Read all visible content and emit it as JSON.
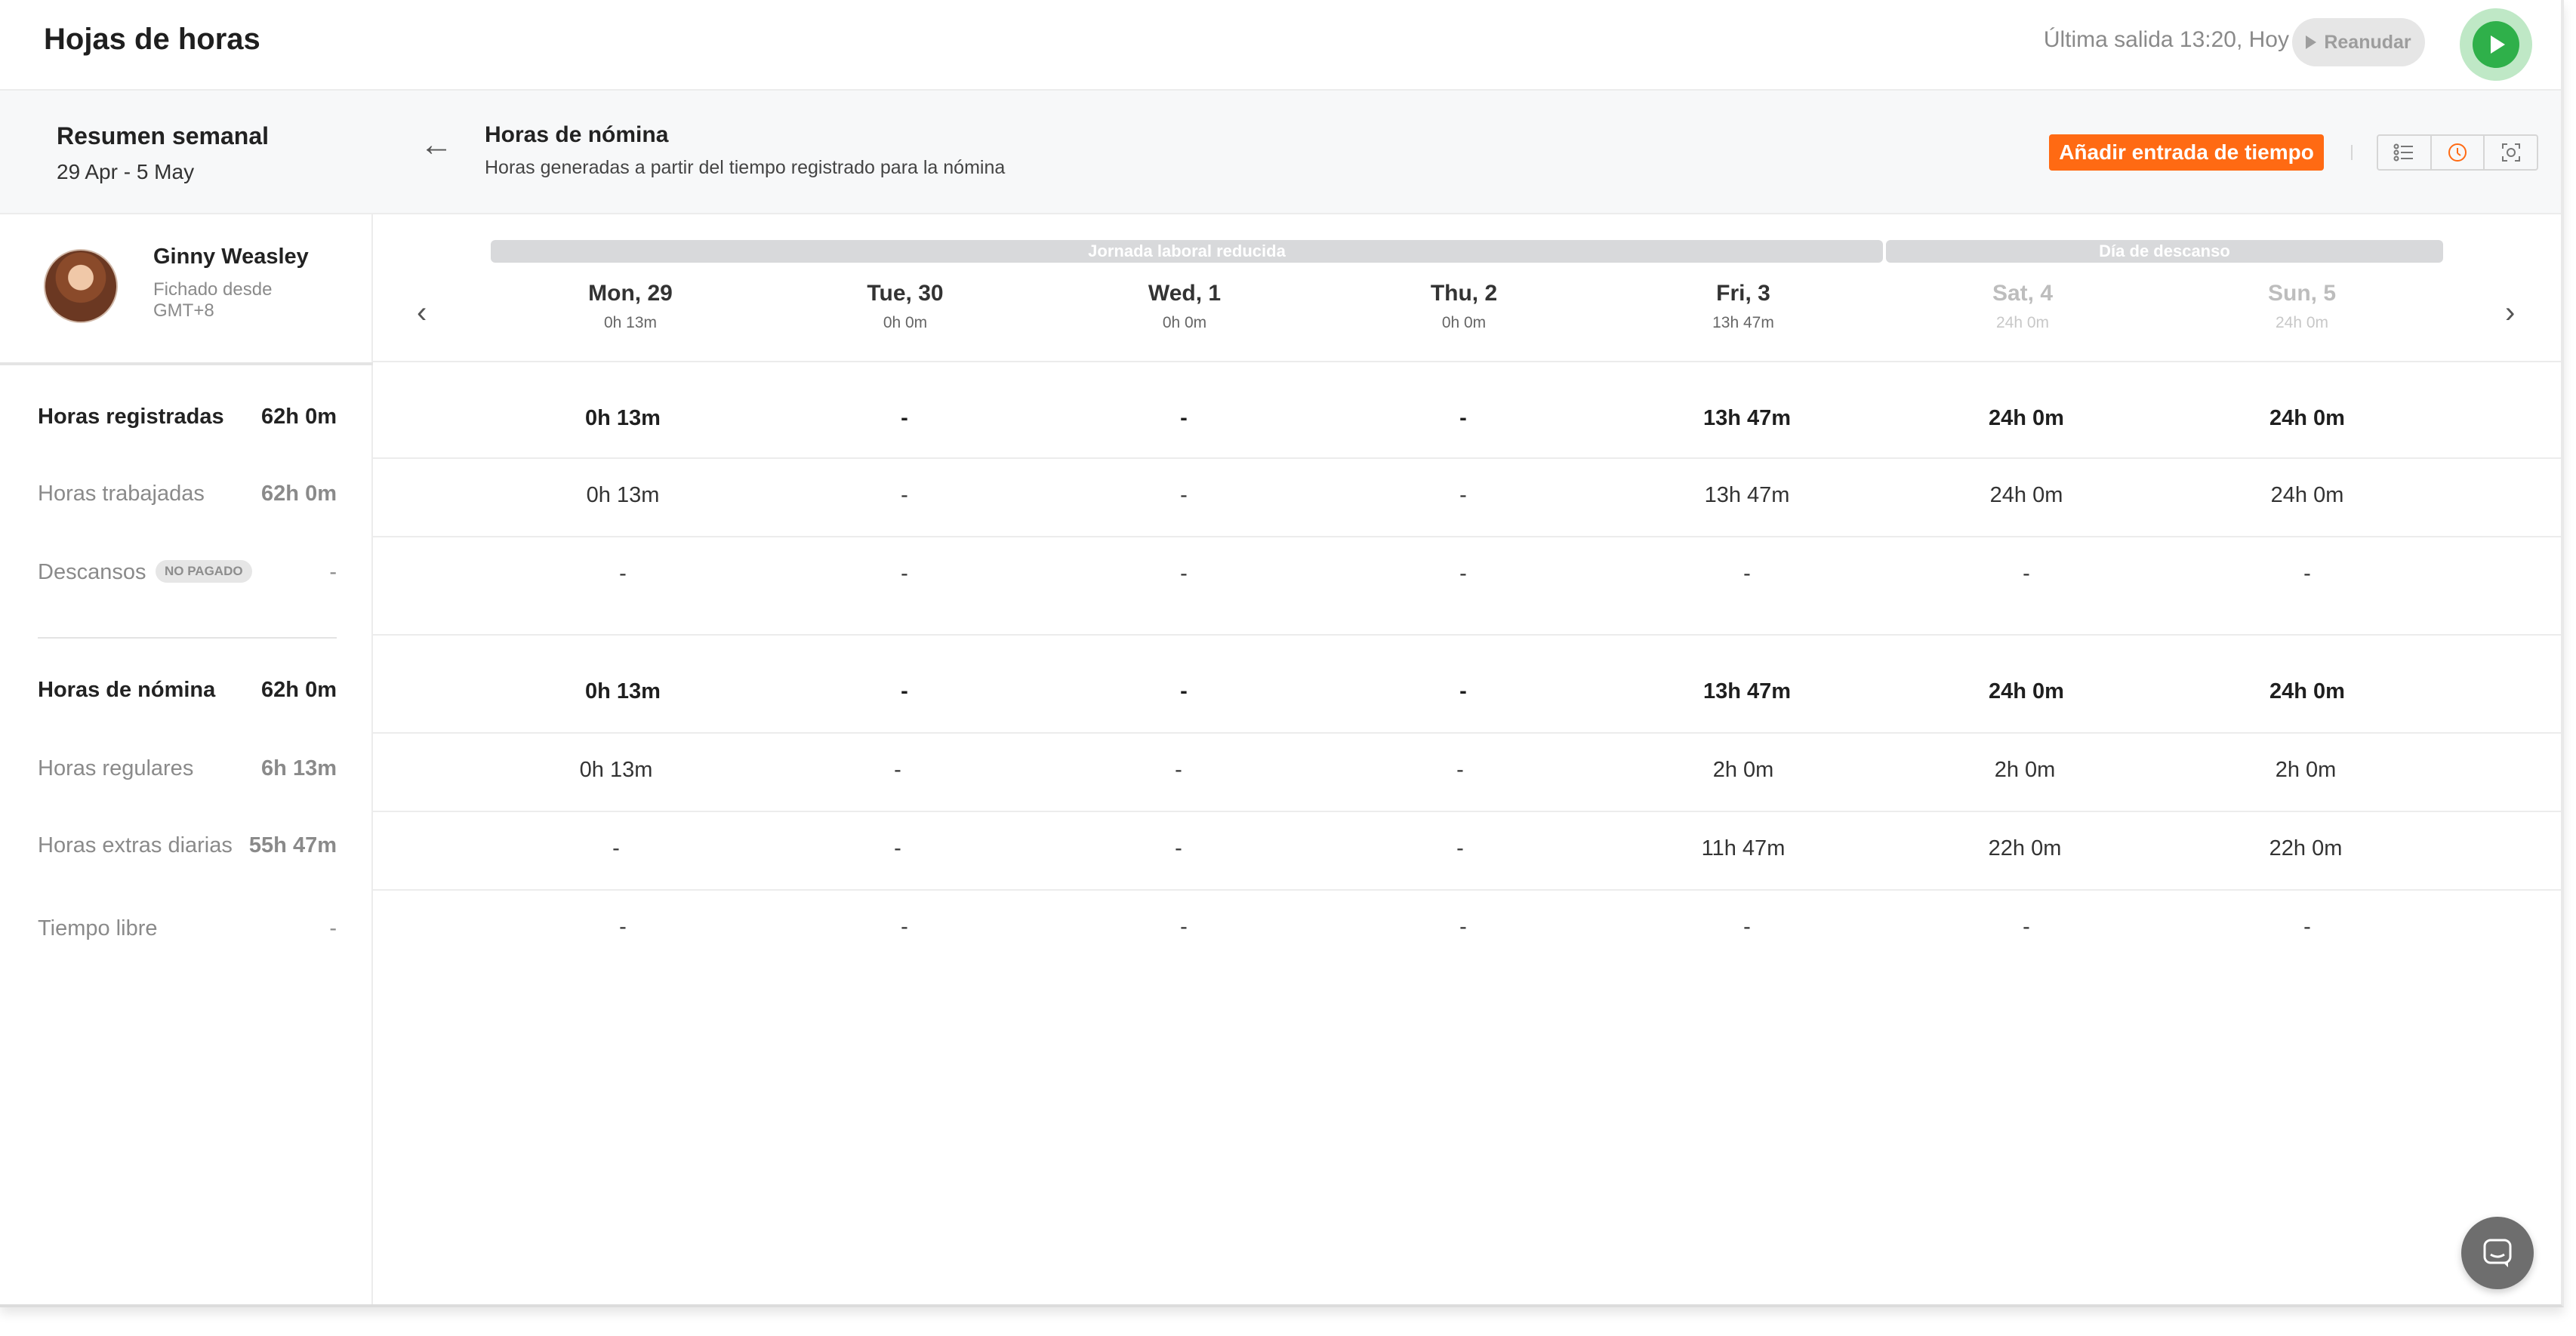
{
  "app": {
    "title": "Hojas de horas"
  },
  "header": {
    "last_out": "Última salida 13:20, Hoy",
    "resume_label": "Reanudar",
    "play_icon": "play-icon"
  },
  "summary": {
    "title": "Resumen semanal",
    "range": "29 Apr - 5 May"
  },
  "person": {
    "name": "Ginny Weasley",
    "clocked_from": "Fichado desde",
    "timezone": "GMT+8"
  },
  "left_rows": [
    {
      "label": "Horas registradas",
      "value": "62h 0m"
    },
    {
      "label": "Horas trabajadas",
      "value": "62h 0m"
    },
    {
      "label": "Descansos",
      "badge": "NO PAGADO",
      "value": "-"
    },
    {
      "label": "Horas de nómina",
      "value": "62h 0m"
    },
    {
      "label": "Horas regulares",
      "value": "6h 13m"
    },
    {
      "label": "Horas extras diarias",
      "value": "55h 47m"
    },
    {
      "label": "Tiempo libre",
      "value": "-"
    }
  ],
  "main_header": {
    "back_icon": "arrow-left-icon",
    "title": "Horas de nómina",
    "subtitle": "Horas generadas a partir del tiempo registrado para la nómina",
    "add_button": "Añadir entrada de tiempo",
    "view_icons": [
      "list-icon",
      "clock-icon",
      "focus-icon"
    ]
  },
  "day_labels": {
    "reduced": "Jornada laboral reducida",
    "rest": "Día de descanso"
  },
  "days": [
    {
      "name": "Mon, 29",
      "hours": "0h 13m"
    },
    {
      "name": "Tue, 30",
      "hours": "0h 0m"
    },
    {
      "name": "Wed, 1",
      "hours": "0h 0m"
    },
    {
      "name": "Thu, 2",
      "hours": "0h 0m"
    },
    {
      "name": "Fri, 3",
      "hours": "13h 47m"
    },
    {
      "name": "Sat, 4",
      "hours": "24h 0m"
    },
    {
      "name": "Sun, 5",
      "hours": "24h 0m"
    }
  ],
  "grid": [
    [
      "0h 13m",
      "-",
      "-",
      "-",
      "13h 47m",
      "24h 0m",
      "24h 0m"
    ],
    [
      "0h 13m",
      "-",
      "-",
      "-",
      "13h 47m",
      "24h 0m",
      "24h 0m"
    ],
    [
      "-",
      "-",
      "-",
      "-",
      "-",
      "-",
      "-"
    ],
    [
      "0h 13m",
      "-",
      "-",
      "-",
      "13h 47m",
      "24h 0m",
      "24h 0m"
    ],
    [
      "0h 13m",
      "-",
      "-",
      "-",
      "2h 0m",
      "2h 0m",
      "2h 0m"
    ],
    [
      "-",
      "-",
      "-",
      "-",
      "11h 47m",
      "22h 0m",
      "22h 0m"
    ],
    [
      "-",
      "-",
      "-",
      "-",
      "-",
      "-",
      "-"
    ]
  ]
}
